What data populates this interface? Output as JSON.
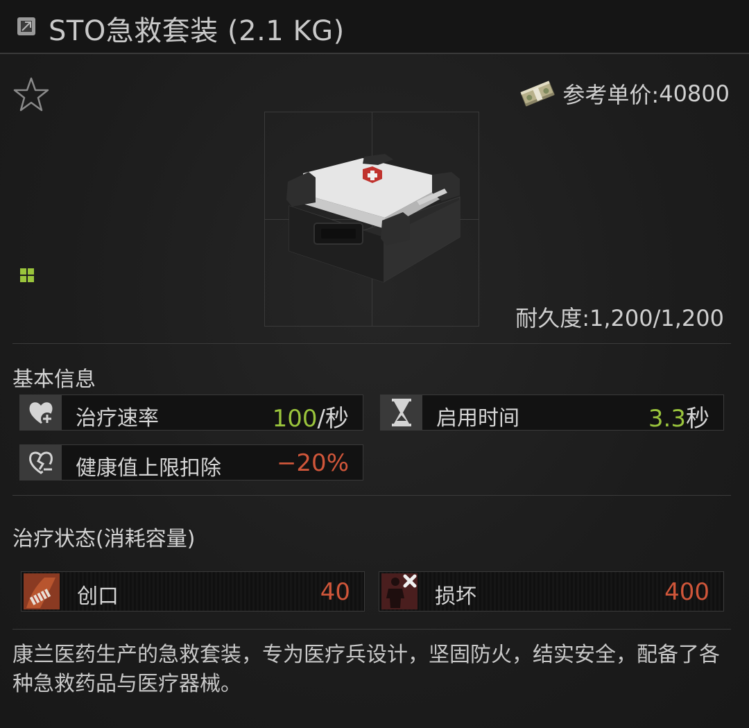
{
  "header": {
    "title": "STO急救套装 (2.1 KG)",
    "icon": "item-info-icon"
  },
  "item": {
    "price_label": "参考单价:",
    "price_value": "40800",
    "durability_label": "耐久度:",
    "durability_value": "1,200/1,200",
    "size_icon": "grid-size-icon",
    "image": "first-aid-kit"
  },
  "basic_info": {
    "title": "基本信息",
    "stats": [
      {
        "label": "治疗速率",
        "value_num": "100",
        "value_unit": "/秒",
        "icon": "heart-plus-icon"
      },
      {
        "label": "启用时间",
        "value_num": "3.3",
        "value_unit": "秒",
        "icon": "hourglass-icon"
      },
      {
        "label": "健康值上限扣除",
        "value": "−20%",
        "icon": "broken-heart-icon"
      }
    ]
  },
  "heal_status": {
    "title": "治疗状态(消耗容量)",
    "items": [
      {
        "label": "创口",
        "value": "40",
        "icon": "wound-icon"
      },
      {
        "label": "损坏",
        "value": "400",
        "icon": "damage-icon"
      }
    ]
  },
  "description": "康兰医药生产的急救套装，专为医疗兵设计，坚固防火，结实安全，配备了各种急救药品与医疗器械。",
  "colors": {
    "positive": "#9ac43c",
    "negative": "#d0563a",
    "background": "#1a1a1a"
  }
}
